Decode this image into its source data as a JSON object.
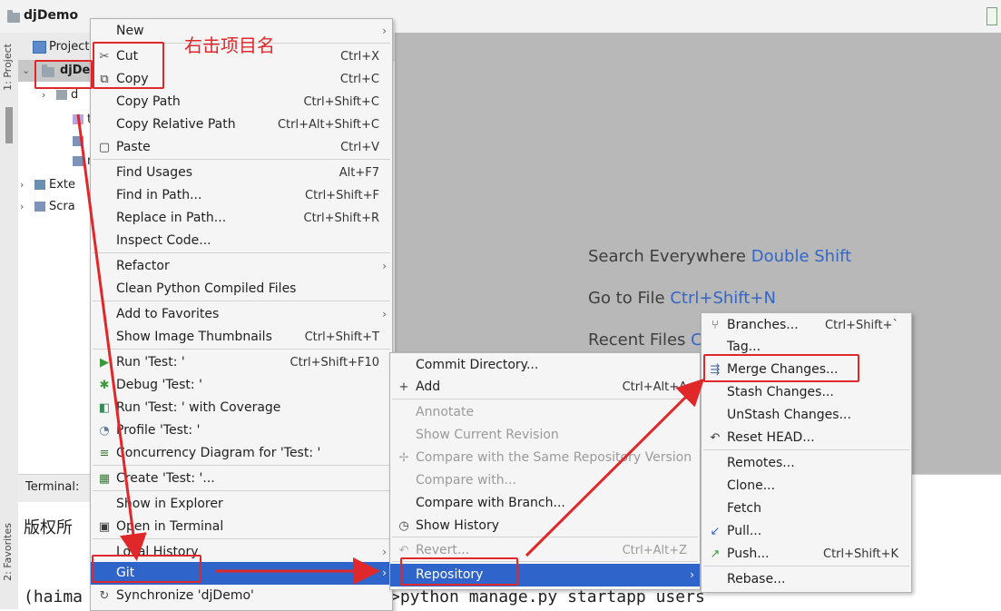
{
  "window": {
    "title": "djDemo"
  },
  "left_strip": {
    "project_label": "1: Project",
    "favorites_label": "2: Favorites"
  },
  "project_panel": {
    "header": "Project",
    "root": "djDemo",
    "tree": [
      {
        "label": "d",
        "icon": "folder-icon",
        "arrow": "›"
      },
      {
        "label": "te",
        "icon": "folder-icon",
        "arrow": ""
      },
      {
        "label": "",
        "icon": "file-icon",
        "arrow": ""
      },
      {
        "label": "n",
        "icon": "python-file-icon",
        "arrow": ""
      },
      {
        "label": "Exte",
        "icon": "library-icon",
        "arrow": "›"
      },
      {
        "label": "Scra",
        "icon": "scratch-icon",
        "arrow": "›"
      }
    ]
  },
  "editor_hints": {
    "search": {
      "label": "Search Everywhere",
      "shortcut": "Double Shift"
    },
    "goto": {
      "label": "Go to File",
      "shortcut": "Ctrl+Shift+N"
    },
    "recent": {
      "label": "Recent Files",
      "shortcut": "C"
    }
  },
  "terminal": {
    "tab": "Terminal:",
    "line1": "版权所",
    "line2_left": "(haima",
    "line2_right": ">python manage.py startapp users"
  },
  "context_menu": {
    "items": [
      {
        "label": "New",
        "shortcut": "",
        "sub": "›",
        "icon": ""
      },
      {
        "label": "Cut",
        "shortcut": "Ctrl+X",
        "sub": "",
        "icon": "✂"
      },
      {
        "label": "Copy",
        "shortcut": "Ctrl+C",
        "sub": "",
        "icon": "⧉"
      },
      {
        "label": "Copy Path",
        "shortcut": "Ctrl+Shift+C",
        "sub": "",
        "icon": ""
      },
      {
        "label": "Copy Relative Path",
        "shortcut": "Ctrl+Alt+Shift+C",
        "sub": "",
        "icon": ""
      },
      {
        "label": "Paste",
        "shortcut": "Ctrl+V",
        "sub": "",
        "icon": "▢"
      },
      {
        "label": "Find Usages",
        "shortcut": "Alt+F7",
        "sub": "",
        "icon": ""
      },
      {
        "label": "Find in Path...",
        "shortcut": "Ctrl+Shift+F",
        "sub": "",
        "icon": ""
      },
      {
        "label": "Replace in Path...",
        "shortcut": "Ctrl+Shift+R",
        "sub": "",
        "icon": ""
      },
      {
        "label": "Inspect Code...",
        "shortcut": "",
        "sub": "",
        "icon": ""
      },
      {
        "label": "Refactor",
        "shortcut": "",
        "sub": "›",
        "icon": ""
      },
      {
        "label": "Clean Python Compiled Files",
        "shortcut": "",
        "sub": "",
        "icon": ""
      },
      {
        "label": "Add to Favorites",
        "shortcut": "",
        "sub": "›",
        "icon": ""
      },
      {
        "label": "Show Image Thumbnails",
        "shortcut": "Ctrl+Shift+T",
        "sub": "",
        "icon": ""
      },
      {
        "label": "Run 'Test: '",
        "shortcut": "Ctrl+Shift+F10",
        "sub": "",
        "icon": "▶"
      },
      {
        "label": "Debug 'Test: '",
        "shortcut": "",
        "sub": "",
        "icon": "✱"
      },
      {
        "label": "Run 'Test: ' with Coverage",
        "shortcut": "",
        "sub": "",
        "icon": "◧"
      },
      {
        "label": "Profile 'Test: '",
        "shortcut": "",
        "sub": "",
        "icon": "◔"
      },
      {
        "label": "Concurrency Diagram for 'Test: '",
        "shortcut": "",
        "sub": "",
        "icon": "≡"
      },
      {
        "label": "Create 'Test: '...",
        "shortcut": "",
        "sub": "",
        "icon": "▦"
      },
      {
        "label": "Show in Explorer",
        "shortcut": "",
        "sub": "",
        "icon": ""
      },
      {
        "label": "Open in Terminal",
        "shortcut": "",
        "sub": "",
        "icon": "▣"
      },
      {
        "label": "Local History",
        "shortcut": "",
        "sub": "›",
        "icon": ""
      },
      {
        "label": "Git",
        "shortcut": "",
        "sub": "›",
        "icon": ""
      },
      {
        "label": "Synchronize 'djDemo'",
        "shortcut": "",
        "sub": "",
        "icon": "↻"
      }
    ]
  },
  "git_menu": {
    "items": [
      {
        "label": "Commit Directory...",
        "shortcut": "",
        "sub": "",
        "icon": ""
      },
      {
        "label": "Add",
        "shortcut": "Ctrl+Alt+A",
        "sub": "",
        "icon": "+"
      },
      {
        "label": "Annotate",
        "shortcut": "",
        "sub": "",
        "icon": ""
      },
      {
        "label": "Show Current Revision",
        "shortcut": "",
        "sub": "",
        "icon": ""
      },
      {
        "label": "Compare with the Same Repository Version",
        "shortcut": "",
        "sub": "",
        "icon": "✢"
      },
      {
        "label": "Compare with...",
        "shortcut": "",
        "sub": "",
        "icon": ""
      },
      {
        "label": "Compare with Branch...",
        "shortcut": "",
        "sub": "",
        "icon": ""
      },
      {
        "label": "Show History",
        "shortcut": "",
        "sub": "",
        "icon": "◷"
      },
      {
        "label": "Revert...",
        "shortcut": "Ctrl+Alt+Z",
        "sub": "",
        "icon": "↶"
      },
      {
        "label": "Repository",
        "shortcut": "",
        "sub": "›",
        "icon": ""
      }
    ]
  },
  "repo_menu": {
    "items": [
      {
        "label": "Branches...",
        "shortcut": "Ctrl+Shift+`",
        "sub": "",
        "icon": "⑂"
      },
      {
        "label": "Tag...",
        "shortcut": "",
        "sub": "",
        "icon": ""
      },
      {
        "label": "Merge Changes...",
        "shortcut": "",
        "sub": "",
        "icon": "⇶"
      },
      {
        "label": "Stash Changes...",
        "shortcut": "",
        "sub": "",
        "icon": ""
      },
      {
        "label": "UnStash Changes...",
        "shortcut": "",
        "sub": "",
        "icon": ""
      },
      {
        "label": "Reset HEAD...",
        "shortcut": "",
        "sub": "",
        "icon": "↶"
      },
      {
        "label": "Remotes...",
        "shortcut": "",
        "sub": "",
        "icon": ""
      },
      {
        "label": "Clone...",
        "shortcut": "",
        "sub": "",
        "icon": ""
      },
      {
        "label": "Fetch",
        "shortcut": "",
        "sub": "",
        "icon": ""
      },
      {
        "label": "Pull...",
        "shortcut": "",
        "sub": "",
        "icon": "↙"
      },
      {
        "label": "Push...",
        "shortcut": "Ctrl+Shift+K",
        "sub": "",
        "icon": "↗"
      },
      {
        "label": "Rebase...",
        "shortcut": "",
        "sub": "",
        "icon": ""
      }
    ]
  },
  "annotation": {
    "text": "右击项目名",
    "color": "#e0282b"
  },
  "colors": {
    "highlight": "#2f65ca",
    "annotation_red": "#e0282b",
    "editor_bg": "#b8b8b8",
    "shortcut_blue": "#3366c7"
  }
}
